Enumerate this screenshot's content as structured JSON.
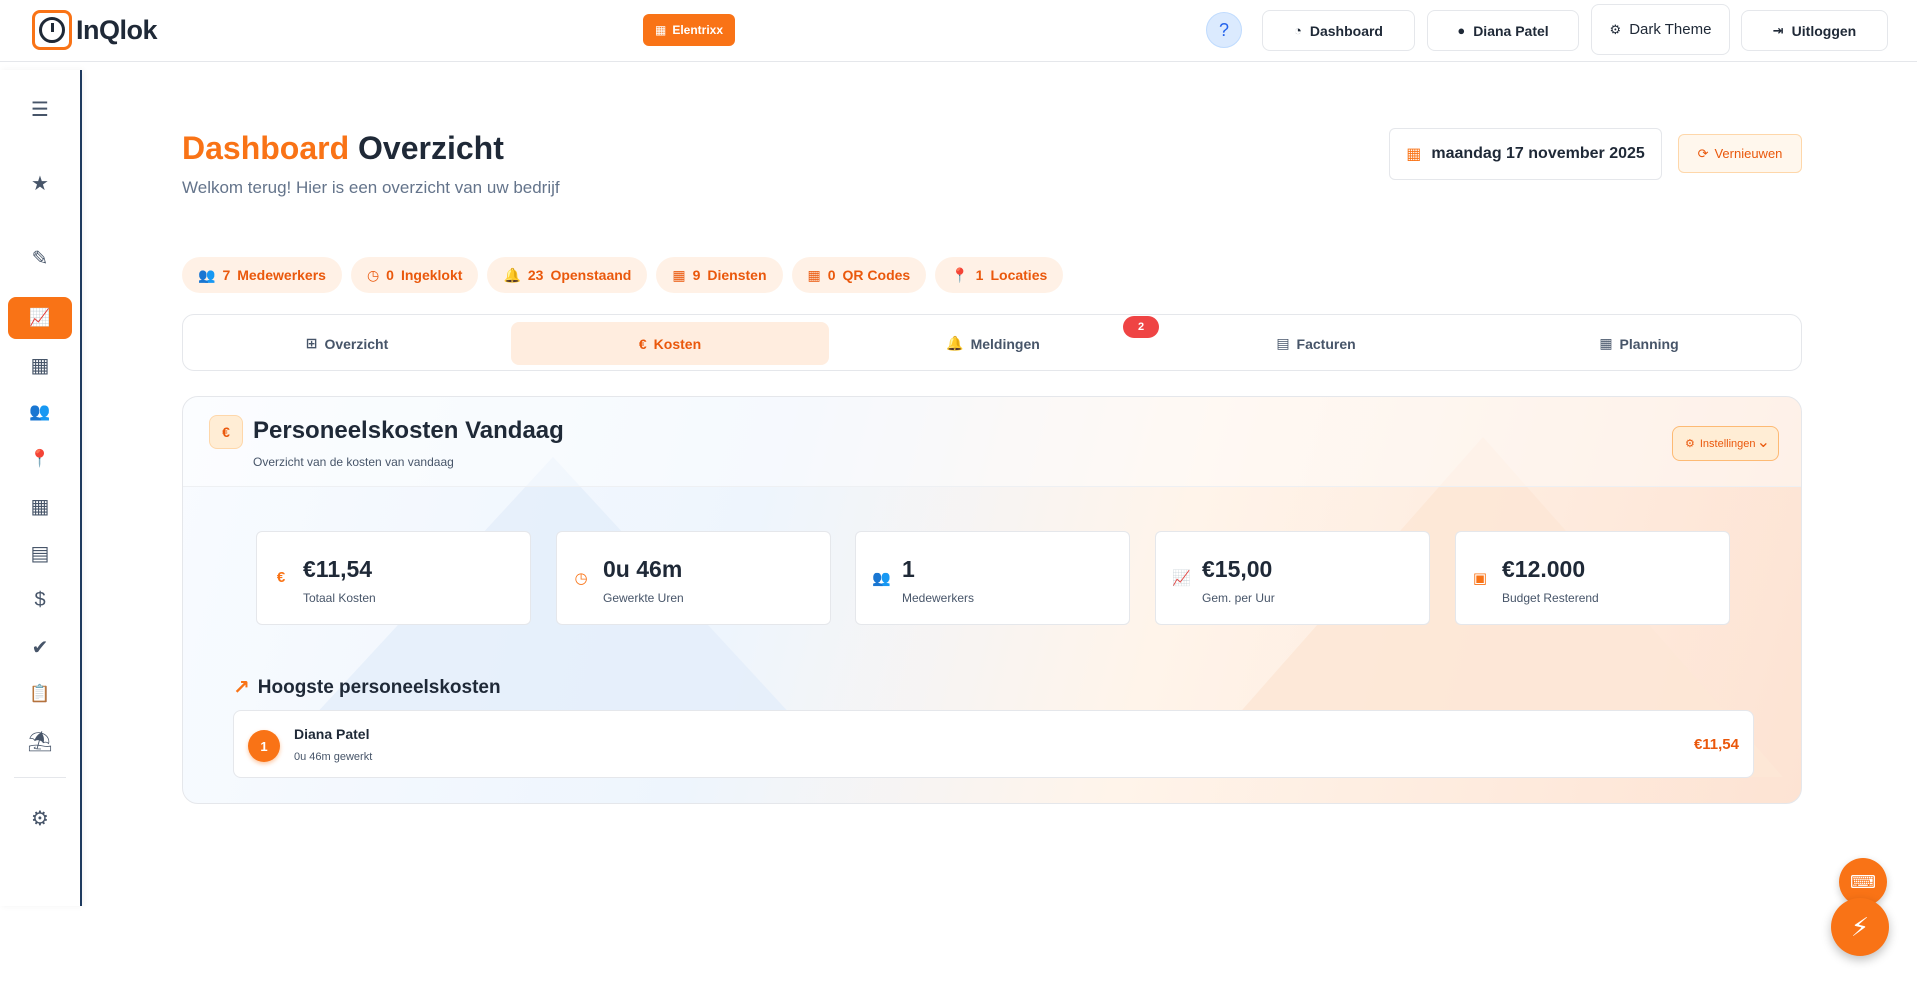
{
  "brand": {
    "name": "InQlok",
    "accent": "#f97316"
  },
  "company": {
    "label": "Elentrixx",
    "icon": "building-icon"
  },
  "header": {
    "help_label": "?",
    "buttons": [
      {
        "label": "Dashboard",
        "icon": "gauge-icon"
      },
      {
        "label": "Diana Patel",
        "icon": "user-icon"
      },
      {
        "label": "Dark Theme",
        "icon": "gear-icon"
      },
      {
        "label": "Uitloggen",
        "icon": "logout-icon"
      }
    ]
  },
  "sidebar": {
    "items": [
      {
        "name": "menu",
        "icon": "menu-icon",
        "glyph": "☰"
      },
      {
        "name": "favorites",
        "icon": "star-icon",
        "glyph": "★"
      },
      {
        "name": "edit",
        "icon": "edit-icon",
        "glyph": "✎"
      },
      {
        "name": "dashboard",
        "icon": "chart-line-icon",
        "glyph": "📈",
        "active": true
      },
      {
        "name": "qr-codes",
        "icon": "qr-code-icon",
        "glyph": "▦"
      },
      {
        "name": "employees",
        "icon": "users-icon",
        "glyph": "👥"
      },
      {
        "name": "locations",
        "icon": "map-pin-icon",
        "glyph": "📍"
      },
      {
        "name": "calendar",
        "icon": "calendar-icon",
        "glyph": "▦"
      },
      {
        "name": "reports",
        "icon": "bar-chart-icon",
        "glyph": "▤"
      },
      {
        "name": "payroll",
        "icon": "hand-coin-icon",
        "glyph": "$"
      },
      {
        "name": "approvals",
        "icon": "check-double-icon",
        "glyph": "✔"
      },
      {
        "name": "tasks",
        "icon": "clipboard-check-icon",
        "glyph": "📋"
      },
      {
        "name": "leave",
        "icon": "umbrella-beach-icon",
        "glyph": "⛱"
      },
      {
        "name": "settings",
        "icon": "cog-icon",
        "glyph": "⚙"
      }
    ]
  },
  "page": {
    "title_accent": "Dashboard",
    "title_rest": "Overzicht",
    "subtitle": "Welkom terug! Hier is een overzicht van uw bedrijf",
    "date": "maandag 17 november 2025",
    "refresh_label": "Vernieuwen"
  },
  "stats": [
    {
      "count": "7",
      "label": "Medewerkers",
      "icon": "users-icon"
    },
    {
      "count": "0",
      "label": "Ingeklokt",
      "icon": "clock-icon"
    },
    {
      "count": "23",
      "label": "Openstaand",
      "icon": "bell-icon"
    },
    {
      "count": "9",
      "label": "Diensten",
      "icon": "calendar-icon"
    },
    {
      "count": "0",
      "label": "QR Codes",
      "icon": "qr-code-icon"
    },
    {
      "count": "1",
      "label": "Locaties",
      "icon": "map-pin-icon"
    }
  ],
  "tabs": [
    {
      "label": "Overzicht",
      "icon": "grid-icon"
    },
    {
      "label": "Kosten",
      "icon": "euro-icon",
      "active": true
    },
    {
      "label": "Meldingen",
      "icon": "bell-icon",
      "badge": "2"
    },
    {
      "label": "Facturen",
      "icon": "file-invoice-icon"
    },
    {
      "label": "Planning",
      "icon": "calendar-icon"
    }
  ],
  "costs": {
    "icon_glyph": "€",
    "title": "Personeelskosten Vandaag",
    "subtitle": "Overzicht van de kosten van vandaag",
    "settings_label": "Instellingen",
    "metrics": [
      {
        "value": "€11,54",
        "label": "Totaal Kosten",
        "icon": "euro-icon"
      },
      {
        "value": "0u 46m",
        "label": "Gewerkte Uren",
        "icon": "clock-icon"
      },
      {
        "value": "1",
        "label": "Medewerkers",
        "icon": "users-icon"
      },
      {
        "value": "€15,00",
        "label": "Gem. per Uur",
        "icon": "chart-line-icon"
      },
      {
        "value": "€12.000",
        "label": "Budget Resterend",
        "icon": "wallet-icon"
      }
    ],
    "top_title": "Hoogste personeelskosten",
    "top_list": [
      {
        "rank": "1",
        "name": "Diana Patel",
        "time": "0u 46m gewerkt",
        "cost": "€11,54"
      }
    ]
  }
}
